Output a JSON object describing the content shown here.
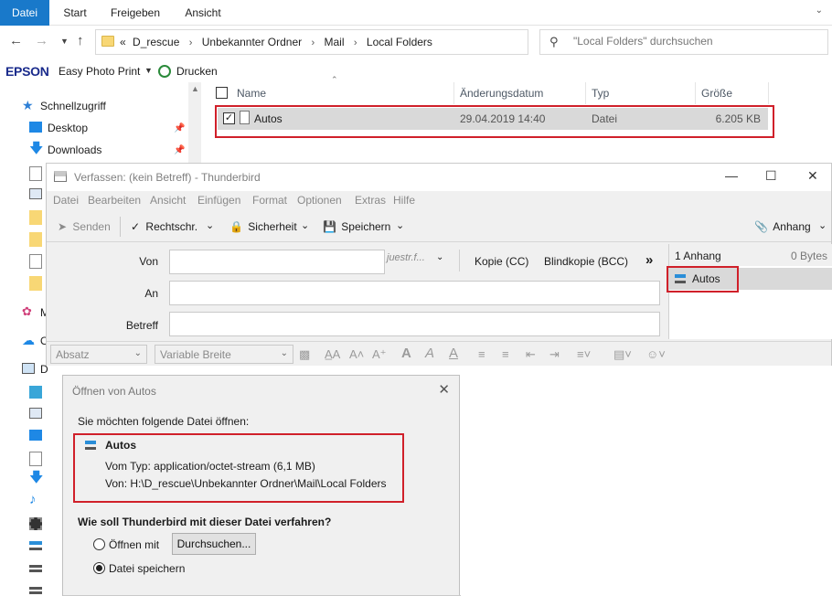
{
  "explorer": {
    "ribbon_tabs": [
      "Datei",
      "Start",
      "Freigeben",
      "Ansicht"
    ],
    "breadcrumbs": [
      "D_rescue",
      "Unbekannter Ordner",
      "Mail",
      "Local Folders"
    ],
    "breadcrumb_prefix": "«",
    "search_placeholder": "\"Local Folders\" durchsuchen",
    "epson": {
      "logo": "EPSON",
      "app": "Easy Photo Print",
      "print": "Drucken"
    },
    "nav": {
      "quick_access": "Schnellzugriff",
      "desktop": "Desktop",
      "downloads": "Downloads",
      "trunc1": "M",
      "trunc2": "O",
      "trunc3": "D"
    },
    "columns": {
      "name": "Name",
      "date": "Änderungsdatum",
      "type": "Typ",
      "size": "Größe"
    },
    "files": [
      {
        "name": "Autos",
        "date": "29.04.2019 14:40",
        "type": "Datei",
        "size": "6.205 KB",
        "checked": true
      }
    ]
  },
  "thunderbird": {
    "title": "Verfassen: (kein Betreff) - Thunderbird",
    "menu": [
      "Datei",
      "Bearbeiten",
      "Ansicht",
      "Einfügen",
      "Format",
      "Optionen",
      "Extras",
      "Hilfe"
    ],
    "toolbar": {
      "send": "Senden",
      "spell": "Rechtschr.",
      "security": "Sicherheit",
      "save": "Speichern",
      "attach": "Anhang"
    },
    "headers": {
      "from_label": "Von",
      "from_extra": "juestr.f...",
      "to_label": "An",
      "subject_label": "Betreff",
      "cc": "Kopie (CC)",
      "bcc": "Blindkopie (BCC)"
    },
    "attachments": {
      "count": "1 Anhang",
      "size": "0 Bytes",
      "items": [
        "Autos"
      ]
    },
    "format_bar": {
      "paragraph": "Absatz",
      "font": "Variable Breite"
    }
  },
  "open_dialog": {
    "title": "Öffnen von Autos",
    "intro": "Sie möchten folgende Datei öffnen:",
    "file_name": "Autos",
    "type_line": "Vom Typ:  application/octet-stream (6,1 MB)",
    "from_line": "Von:  H:\\D_rescue\\Unbekannter Ordner\\Mail\\Local Folders",
    "question": "Wie soll Thunderbird mit dieser Datei verfahren?",
    "open_with": "Öffnen mit",
    "browse": "Durchsuchen...",
    "save_file": "Datei speichern",
    "selected": "save_file"
  },
  "colors": {
    "highlight": "#d0202a",
    "ribbon_file": "#1979ca",
    "selection": "#d9d9d9"
  }
}
